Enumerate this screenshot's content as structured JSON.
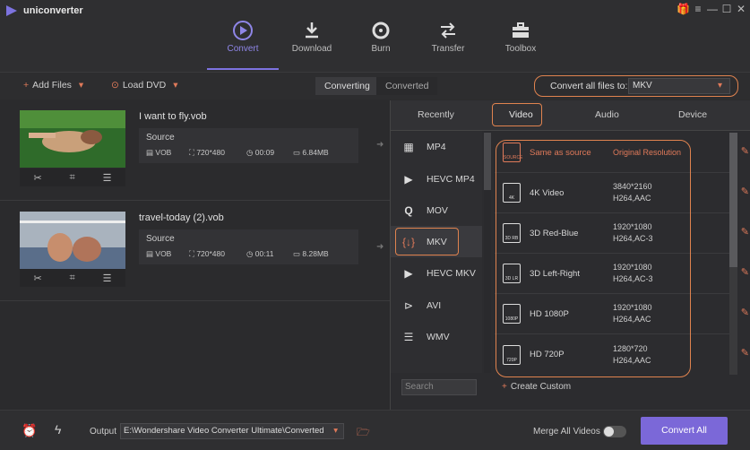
{
  "app": {
    "name": "uniconverter"
  },
  "nav": [
    {
      "label": "Convert",
      "icon": "convert-icon",
      "active": true
    },
    {
      "label": "Download",
      "icon": "download-icon"
    },
    {
      "label": "Burn",
      "icon": "burn-icon"
    },
    {
      "label": "Transfer",
      "icon": "transfer-icon"
    },
    {
      "label": "Toolbox",
      "icon": "toolbox-icon"
    }
  ],
  "toolbar": {
    "add_files": "Add Files",
    "load_dvd": "Load DVD",
    "converting": "Converting",
    "converted": "Converted",
    "convert_all_label": "Convert all files to:",
    "convert_all_value": "MKV"
  },
  "files": [
    {
      "name": "I want to fly.vob",
      "source_label": "Source",
      "format": "VOB",
      "resolution": "720*480",
      "duration": "00:09",
      "size": "6.84MB"
    },
    {
      "name": "travel-today (2).vob",
      "source_label": "Source",
      "format": "VOB",
      "resolution": "720*480",
      "duration": "00:11",
      "size": "8.28MB"
    }
  ],
  "panel": {
    "tabs": [
      "Recently",
      "Video",
      "Audio",
      "Device"
    ],
    "formats": [
      "MP4",
      "HEVC MP4",
      "MOV",
      "MKV",
      "HEVC MKV",
      "AVI",
      "WMV"
    ],
    "presets": [
      {
        "name": "Same as source",
        "res": "Original Resolution",
        "codec": "",
        "icon_text": "SOURCE"
      },
      {
        "name": "4K Video",
        "res": "3840*2160",
        "codec": "H264,AAC",
        "icon_text": "4K"
      },
      {
        "name": "3D Red-Blue",
        "res": "1920*1080",
        "codec": "H264,AC-3",
        "icon_text": "3D RB"
      },
      {
        "name": "3D Left-Right",
        "res": "1920*1080",
        "codec": "H264,AC-3",
        "icon_text": "3D LR"
      },
      {
        "name": "HD 1080P",
        "res": "1920*1080",
        "codec": "H264,AAC",
        "icon_text": "1080P"
      },
      {
        "name": "HD 720P",
        "res": "1280*720",
        "codec": "H264,AAC",
        "icon_text": "720P"
      }
    ],
    "search_placeholder": "Search",
    "create_custom": "Create Custom"
  },
  "bottom": {
    "output_label": "Output",
    "output_path": "E:\\Wondershare Video Converter Ultimate\\Converted",
    "merge_label": "Merge All Videos",
    "convert_all": "Convert All"
  },
  "colors": {
    "accent": "#7d73e0",
    "highlight": "#e0834f",
    "button": "#7b68d8"
  }
}
